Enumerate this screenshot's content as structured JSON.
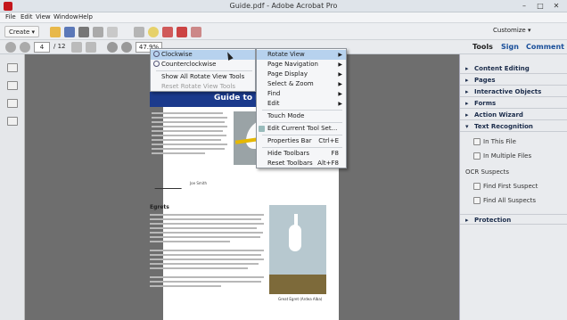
{
  "window": {
    "title": "Guide.pdf - Adobe Acrobat Pro",
    "minimize": "–",
    "maximize": "□",
    "close": "✕"
  },
  "menubar": [
    "File",
    "Edit",
    "View",
    "Window",
    "Help"
  ],
  "toolbar": {
    "create_label": "Create",
    "customize_label": "Customize"
  },
  "nav": {
    "page_current": "4",
    "page_total": "/ 12",
    "zoom": "47.9%"
  },
  "right_tabs": [
    "Tools",
    "Sign",
    "Comment"
  ],
  "right_panel": {
    "sections": [
      "Content Editing",
      "Pages",
      "Interactive Objects",
      "Forms",
      "Action Wizard",
      "Text Recognition"
    ],
    "text_recognition_items": [
      "In This File",
      "In Multiple Files"
    ],
    "ocr_title": "OCR Suspects",
    "ocr_items": [
      "Find First Suspect",
      "Find All Suspects"
    ],
    "protection": "Protection"
  },
  "rotate_menu": {
    "items": [
      "Clockwise",
      "Counterclockwise",
      "Show All Rotate View Tools",
      "Reset Rotate View Tools"
    ]
  },
  "view_menu": {
    "items": [
      {
        "label": "Rotate View",
        "shortcut": ""
      },
      {
        "label": "Page Navigation",
        "shortcut": ""
      },
      {
        "label": "Page Display",
        "shortcut": ""
      },
      {
        "label": "Select & Zoom",
        "shortcut": ""
      },
      {
        "label": "Find",
        "shortcut": ""
      },
      {
        "label": "Edit",
        "shortcut": ""
      },
      {
        "label": "Touch Mode",
        "shortcut": ""
      },
      {
        "label": "Edit Current Tool Set...",
        "shortcut": ""
      },
      {
        "label": "Properties Bar",
        "shortcut": "Ctrl+E"
      },
      {
        "label": "Hide Toolbars",
        "shortcut": "F8"
      },
      {
        "label": "Reset Toolbars",
        "shortcut": "Alt+F8"
      }
    ]
  },
  "document": {
    "banner": "Guide to Egrets and",
    "heading": "Egrets",
    "caption": "Great Egret (Ardea Alba)",
    "signature_name": "Joe Smith"
  },
  "colors": {
    "banner": "#1b3a8c",
    "highlight": "#b7d2ee",
    "acrobat_red": "#c4161c"
  }
}
